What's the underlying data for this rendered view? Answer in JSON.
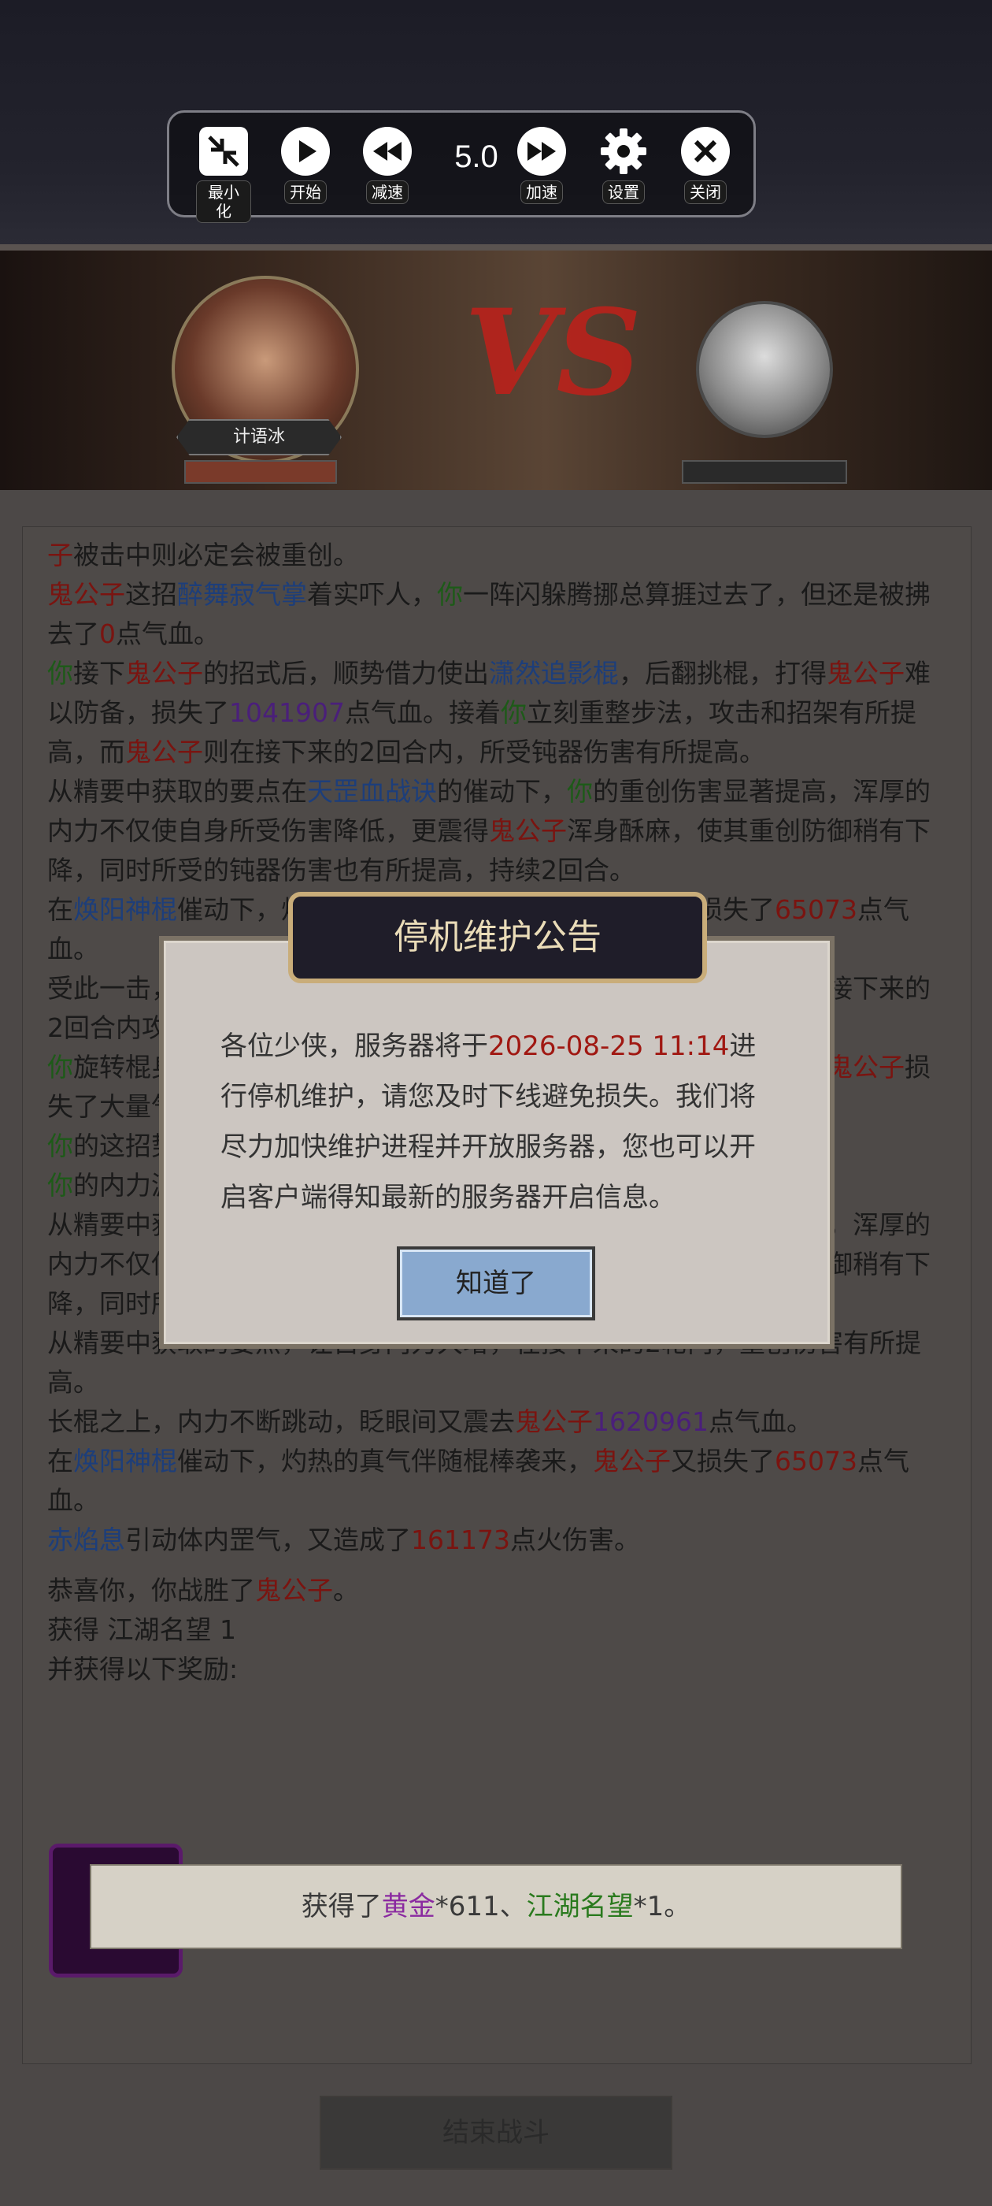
{
  "controls": {
    "minimize": "最小化",
    "start": "开始",
    "slow": "减速",
    "speed": "5.0",
    "fast": "加速",
    "settings": "设置",
    "close": "关闭"
  },
  "battle": {
    "player_name": "计语冰",
    "vs_text": "VS"
  },
  "log": [
    [
      {
        "t": "子",
        "c": "red"
      },
      {
        "t": "被击中则必定会被重创。"
      }
    ],
    [
      {
        "t": "鬼公子",
        "c": "red"
      },
      {
        "t": "这招"
      },
      {
        "t": "醉舞寂气掌",
        "c": "blue"
      },
      {
        "t": "着实吓人，"
      },
      {
        "t": "你",
        "c": "green"
      },
      {
        "t": "一阵闪躲腾挪总算捱过去了，但还是被拂去了"
      },
      {
        "t": "0",
        "c": "red"
      },
      {
        "t": "点气血。"
      }
    ],
    [
      {
        "t": "你",
        "c": "green"
      },
      {
        "t": "接下"
      },
      {
        "t": "鬼公子",
        "c": "red"
      },
      {
        "t": "的招式后，顺势借力使出"
      },
      {
        "t": "潇然追影棍",
        "c": "blue"
      },
      {
        "t": "，后翻挑棍，打得"
      },
      {
        "t": "鬼公子",
        "c": "red"
      },
      {
        "t": "难以防备，损失了"
      },
      {
        "t": "1041907",
        "c": "purple"
      },
      {
        "t": "点气血。接着"
      },
      {
        "t": "你",
        "c": "green"
      },
      {
        "t": "立刻重整步法，攻击和招架有所提高，而"
      },
      {
        "t": "鬼公子",
        "c": "red"
      },
      {
        "t": "则在接下来的2回合内，所受钝器伤害有所提高。"
      }
    ],
    [
      {
        "t": "从精要中获取的要点在"
      },
      {
        "t": "天罡血战诀",
        "c": "blue"
      },
      {
        "t": "的催动下，"
      },
      {
        "t": "你",
        "c": "green"
      },
      {
        "t": "的重创伤害显著提高，浑厚的内力不仅使自身所受伤害降低，更震得"
      },
      {
        "t": "鬼公子",
        "c": "red"
      },
      {
        "t": "浑身酥麻，使其重创防御稍有下降，同时所受的钝器伤害也有所提高，持续2回合。"
      }
    ],
    [
      {
        "t": "在"
      },
      {
        "t": "焕阳神棍",
        "c": "blue"
      },
      {
        "t": "催动下，灼热的真气伴随棍棒袭来，"
      },
      {
        "t": "鬼公子",
        "c": "red"
      },
      {
        "t": "又损失了"
      },
      {
        "t": "65073",
        "c": "red"
      },
      {
        "t": "点气血。"
      }
    ],
    [
      {
        "t": "受此一击，"
      },
      {
        "t": "鬼公子",
        "c": "red"
      },
      {
        "t": "气血翻涌，"
      },
      {
        "t": "你",
        "c": "green"
      },
      {
        "t": "趁势稳住脚步。丹田内力奔涌，"
      },
      {
        "t": "你",
        "c": "green"
      },
      {
        "t": "在接下来的2回合内攻击有所提高。"
      }
    ],
    [
      {
        "t": "你",
        "c": "green"
      },
      {
        "t": "旋转棍身，借力腾空而起，对着"
      },
      {
        "t": "鬼公子",
        "c": "red"
      },
      {
        "t": "当头一棍，接着一棍撞去，"
      },
      {
        "t": "鬼公子",
        "c": "red"
      },
      {
        "t": "损失了大量气血。"
      }
    ],
    [
      {
        "t": "你",
        "c": "green"
      },
      {
        "t": "的这招势大力沉，在接下来的2回合内，重创伤害显著提升了。"
      }
    ],
    [
      {
        "t": "你",
        "c": "green"
      },
      {
        "t": "的内力源源不断，在接下来的2回合内可以追加攻击。"
      }
    ],
    [
      {
        "t": "从精要中获取的要点在"
      },
      {
        "t": "天罡血战诀",
        "c": "blue"
      },
      {
        "t": "的催动下，"
      },
      {
        "t": "你",
        "c": "green"
      },
      {
        "t": "的重创伤害显著提高，浑厚的内力不仅使自身所受伤害降低，更震得"
      },
      {
        "t": "鬼公子",
        "c": "red"
      },
      {
        "t": "浑身酥麻，使其重创防御稍有下降，同时所受的钝器伤害也有所提高，持续2回合。"
      }
    ],
    [
      {
        "t": "从精要中获取的要点，让自身内力大增，在接下来的2轮内，重创伤害有所提高。"
      }
    ],
    [
      {
        "t": "长棍之上，内力不断跳动，眨眼间又震去"
      },
      {
        "t": "鬼公子",
        "c": "red"
      },
      {
        "t": "1620961",
        "c": "purple"
      },
      {
        "t": "点气血。"
      }
    ],
    [
      {
        "t": "在"
      },
      {
        "t": "焕阳神棍",
        "c": "blue"
      },
      {
        "t": "催动下，灼热的真气伴随棍棒袭来，"
      },
      {
        "t": "鬼公子",
        "c": "red"
      },
      {
        "t": "又损失了"
      },
      {
        "t": "65073",
        "c": "red"
      },
      {
        "t": "点气血。"
      }
    ],
    [
      {
        "t": "赤焰息",
        "c": "blue"
      },
      {
        "t": "引动体内罡气，又造成了"
      },
      {
        "t": "161173",
        "c": "red"
      },
      {
        "t": "点火伤害。"
      }
    ],
    [
      {
        "t": "恭喜你，你战胜了"
      },
      {
        "t": "鬼公子",
        "c": "red"
      },
      {
        "t": "。"
      }
    ],
    [
      {
        "t": "获得 江湖名望 1"
      }
    ],
    [
      {
        "t": "并获得以下奖励:"
      }
    ]
  ],
  "end_battle": "结束战斗",
  "toast": {
    "prefix": "获得了",
    "gold": "黄金",
    "gold_qty": "*611、",
    "fame": "江湖名望",
    "fame_qty": "*1。"
  },
  "modal": {
    "title": "停机维护公告",
    "body_1": "各位少侠，服务器将于",
    "date": "2026-08-25 11:14",
    "body_2": "进行停机维护，请您及时下线避免损失。我们将尽力加快维护进程并开放服务器，您也可以开启客户端得知最新的服务器开启信息。",
    "ok": "知道了"
  }
}
